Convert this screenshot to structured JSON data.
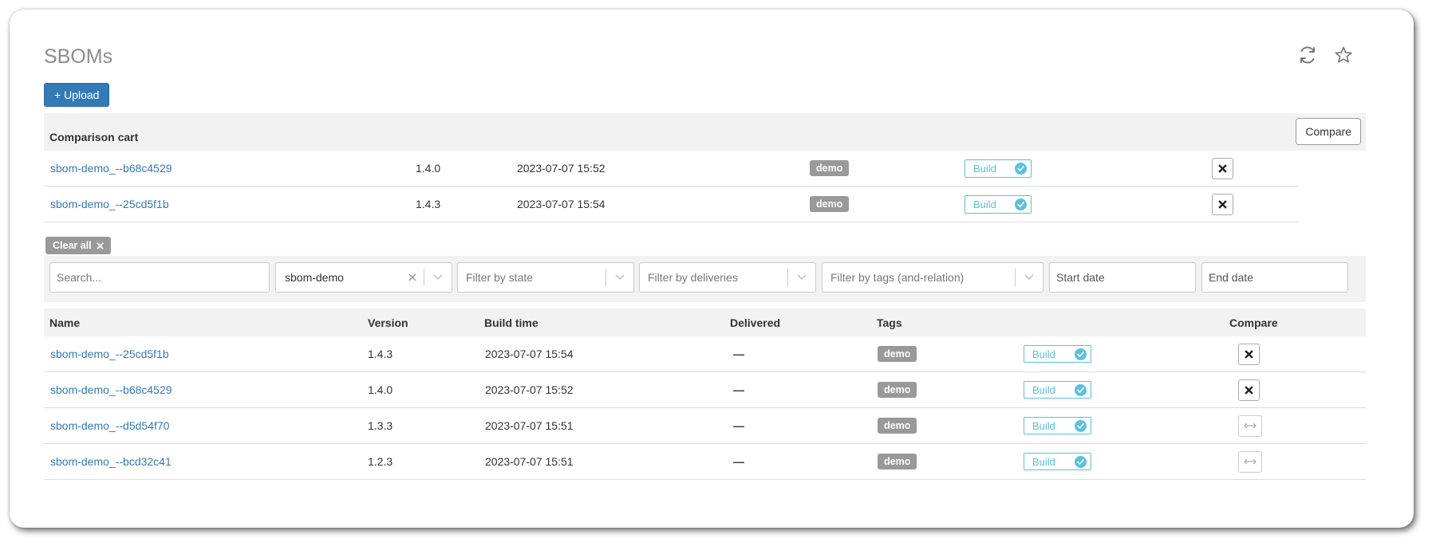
{
  "page": {
    "title": "SBOMs",
    "upload_label": "+ Upload"
  },
  "header_icons": [
    "refresh-icon",
    "star-icon"
  ],
  "cart": {
    "title": "Comparison cart",
    "compare_label": "Compare",
    "rows": [
      {
        "name": "sbom-demo_--b68c4529",
        "version": "1.4.0",
        "build_time": "2023-07-07 15:52",
        "tag": "demo",
        "state": "Build"
      },
      {
        "name": "sbom-demo_--25cd5f1b",
        "version": "1.4.3",
        "build_time": "2023-07-07 15:54",
        "tag": "demo",
        "state": "Build"
      }
    ]
  },
  "filters": {
    "clear_all_label": "Clear all",
    "search_placeholder": "Search...",
    "product_value": "sbom-demo",
    "state_placeholder": "Filter by state",
    "deliveries_placeholder": "Filter by deliveries",
    "tags_placeholder": "Filter by tags (and-relation)",
    "start_placeholder": "Start date",
    "end_placeholder": "End date"
  },
  "table": {
    "columns": [
      "Name",
      "Version",
      "Build time",
      "Delivered",
      "Tags",
      "Compare"
    ],
    "rows": [
      {
        "name": "sbom-demo_--25cd5f1b",
        "version": "1.4.3",
        "build_time": "2023-07-07 15:54",
        "delivered": "—",
        "tag": "demo",
        "state": "Build",
        "in_cart": true
      },
      {
        "name": "sbom-demo_--b68c4529",
        "version": "1.4.0",
        "build_time": "2023-07-07 15:52",
        "delivered": "—",
        "tag": "demo",
        "state": "Build",
        "in_cart": true
      },
      {
        "name": "sbom-demo_--d5d54f70",
        "version": "1.3.3",
        "build_time": "2023-07-07 15:51",
        "delivered": "—",
        "tag": "demo",
        "state": "Build",
        "in_cart": false
      },
      {
        "name": "sbom-demo_--bcd32c41",
        "version": "1.2.3",
        "build_time": "2023-07-07 15:51",
        "delivered": "—",
        "tag": "demo",
        "state": "Build",
        "in_cart": false
      }
    ]
  },
  "colors": {
    "primary": "#337ab7",
    "info": "#5bc0de",
    "tag_bg": "#999999",
    "panel_bg": "#f2f2f2"
  }
}
